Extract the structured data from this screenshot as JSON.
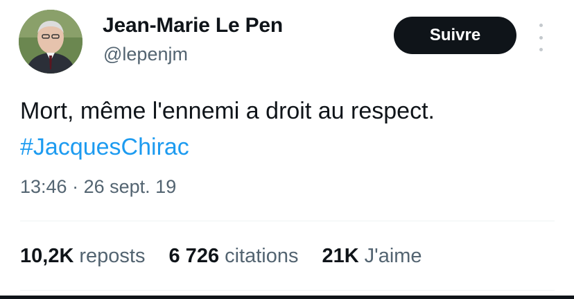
{
  "author": {
    "name": "Jean-Marie Le Pen",
    "handle": "@lepenjm",
    "avatar_icon": "profile-photo"
  },
  "follow_button": {
    "label": "Suivre"
  },
  "more_button": {
    "icon": "more-vertical-icon"
  },
  "tweet": {
    "text": "Mort, même l'ennemi a droit au respect.",
    "hashtag": "#JacquesChirac",
    "time": "13:46",
    "separator": "·",
    "date": "26 sept. 19"
  },
  "stats": [
    {
      "value": "10,2K",
      "label": "reposts"
    },
    {
      "value": "6 726",
      "label": "citations"
    },
    {
      "value": "21K",
      "label": "J'aime"
    }
  ],
  "colors": {
    "text": "#0f1419",
    "secondary": "#536471",
    "link": "#1d9bf0",
    "button_bg": "#0f1419",
    "divider": "#eff3f4"
  }
}
